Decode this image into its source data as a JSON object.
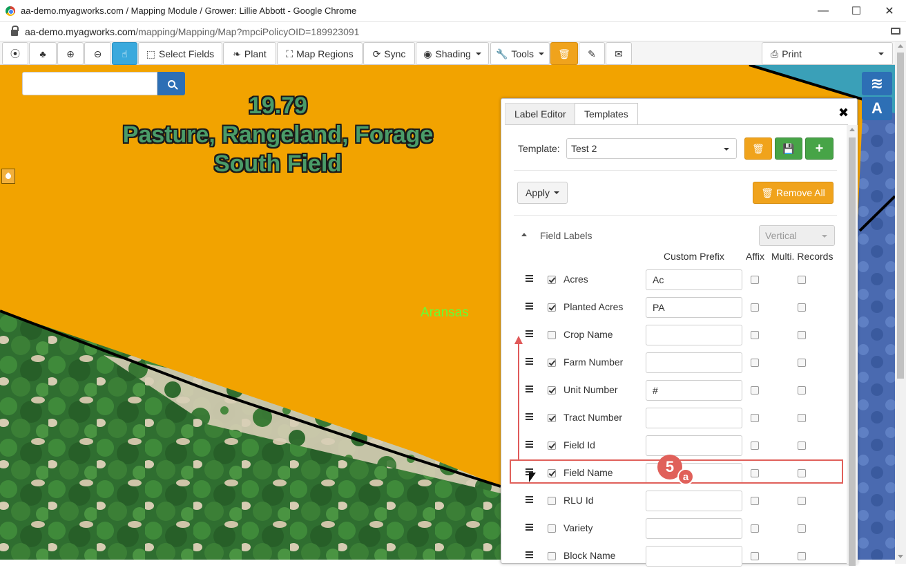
{
  "window": {
    "title": "aa-demo.myagworks.com / Mapping Module / Grower: Lillie Abbott - Google Chrome",
    "minimize": "—",
    "maximize": "☐",
    "close": "✕"
  },
  "address": {
    "host": "aa-demo.myagworks.com",
    "path": "/mapping/Mapping/Map?mpciPolicyOID=189923091"
  },
  "toolbar": {
    "locate_icon": "⦿",
    "tree_icon": "♣",
    "zoom_in_icon": "⊕",
    "zoom_out_icon": "⊖",
    "pointer_icon": "☝",
    "select_fields": "Select Fields",
    "plant": "Plant",
    "map_regions": "Map Regions",
    "sync": "Sync",
    "shading": "Shading",
    "tools": "Tools",
    "delete_icon": "🗑",
    "edit_icon": "✎",
    "email_icon": "✉",
    "print": "Print"
  },
  "map": {
    "search_placeholder": "",
    "field_label": {
      "acres": "19.79",
      "crop": "Pasture, Rangeland, Forage",
      "name": "South Field"
    },
    "county_label": "Aransas",
    "layers_icon": "≋",
    "label_tool": "A",
    "colors": {
      "field": "#f2a300",
      "field_boundary": "#000000",
      "water": "#3d9fb5",
      "vegetation": "#2c6b30"
    }
  },
  "panel": {
    "tabs": [
      "Label Editor",
      "Templates"
    ],
    "active_tab": "Templates",
    "close": "✖",
    "template_label": "Template:",
    "template_value": "Test 2",
    "apply": "Apply",
    "remove_all": "Remove All",
    "section": "Field Labels",
    "orientation": "Vertical",
    "columns": {
      "prefix": "Custom Prefix",
      "affix": "Affix",
      "multi": "Multi. Records"
    },
    "rows": [
      {
        "name": "Acres",
        "checked": true,
        "prefix": "Ac"
      },
      {
        "name": "Planted Acres",
        "checked": true,
        "prefix": "PA"
      },
      {
        "name": "Crop Name",
        "checked": false,
        "prefix": ""
      },
      {
        "name": "Farm Number",
        "checked": true,
        "prefix": ""
      },
      {
        "name": "Unit Number",
        "checked": true,
        "prefix": "#"
      },
      {
        "name": "Tract Number",
        "checked": true,
        "prefix": ""
      },
      {
        "name": "Field Id",
        "checked": true,
        "prefix": ""
      },
      {
        "name": "Field Name",
        "checked": true,
        "prefix": ""
      },
      {
        "name": "RLU Id",
        "checked": false,
        "prefix": ""
      },
      {
        "name": "Variety",
        "checked": false,
        "prefix": ""
      },
      {
        "name": "Block Name",
        "checked": false,
        "prefix": ""
      }
    ]
  },
  "annotation": {
    "step": "5",
    "sub": "a",
    "color": "#e0605a"
  }
}
